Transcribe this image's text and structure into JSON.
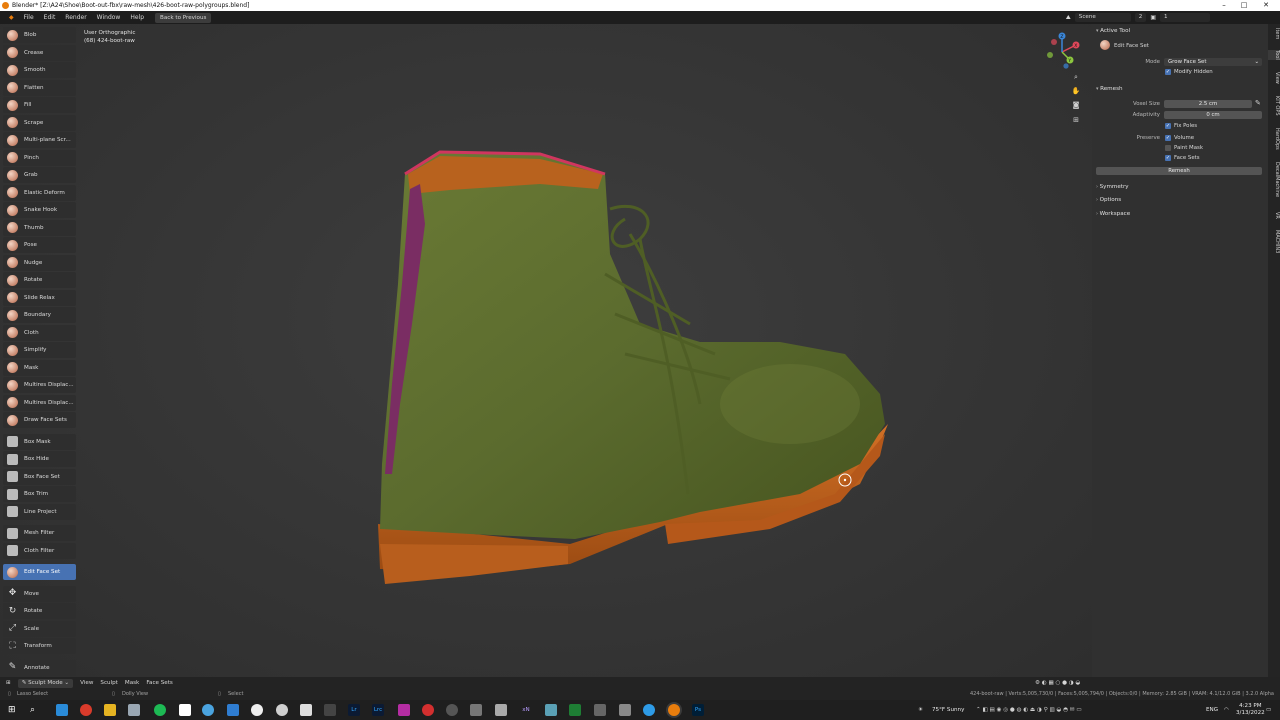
{
  "window": {
    "title": "Blender* [Z:\\A24\\Shoe\\Boot-out-fbx\\raw-mesh\\426-boot-raw-polygroups.blend]",
    "min": "–",
    "max": "□",
    "close": "✕"
  },
  "menu": {
    "items": [
      "File",
      "Edit",
      "Render",
      "Window",
      "Help"
    ],
    "back_button": "Back to Previous",
    "scene_label": "Scene",
    "scene_count": "2",
    "view_layer": "1"
  },
  "viewport": {
    "view_name": "User Orthographic",
    "object_line": "(68) 424-boot-raw"
  },
  "toolbar": {
    "groups": [
      [
        "Blob",
        "Crease",
        "Smooth",
        "Flatten",
        "Fill",
        "Scrape",
        "Multi-plane Scr...",
        "Pinch",
        "Grab",
        "Elastic Deform",
        "Snake Hook",
        "Thumb",
        "Pose",
        "Nudge",
        "Rotate",
        "Slide Relax",
        "Boundary",
        "Cloth",
        "Simplify",
        "Mask",
        "Multires Displac...",
        "Multires Displac...",
        "Draw Face Sets"
      ],
      [
        "Box Mask",
        "Box Hide",
        "Box Face Set",
        "Box Trim",
        "Line Project"
      ],
      [
        "Mesh Filter",
        "Cloth Filter"
      ],
      [
        "Edit Face Set"
      ],
      [
        "Move",
        "Rotate",
        "Scale",
        "Transform"
      ],
      [
        "Annotate"
      ]
    ],
    "active": "Edit Face Set"
  },
  "gizmo": {
    "x": "X",
    "y": "Y",
    "z": "Z"
  },
  "sidebar": {
    "tabs": [
      "Item",
      "Tool",
      "View",
      "KIT OPS",
      "HardOps",
      "DecalMachine",
      "VR",
      "MACHIN3"
    ],
    "active_tool": {
      "header": "Active Tool",
      "tool_name": "Edit Face Set",
      "mode_label": "Mode",
      "mode_value": "Grow Face Set",
      "modify_hidden": "Modify Hidden"
    },
    "remesh": {
      "header": "Remesh",
      "voxel_size_label": "Voxel Size",
      "voxel_size_value": "2.5 cm",
      "adaptivity_label": "Adaptivity",
      "adaptivity_value": "0 cm",
      "fix_poles": "Fix Poles",
      "preserve_label": "Preserve",
      "volume": "Volume",
      "paint_mask": "Paint Mask",
      "face_sets": "Face Sets",
      "button": "Remesh"
    },
    "collapsed": [
      "Symmetry",
      "Options",
      "Workspace"
    ]
  },
  "modebar": {
    "mode": "Sculpt Mode",
    "items": [
      "View",
      "Sculpt",
      "Mask",
      "Face Sets"
    ]
  },
  "statusbar": {
    "lasso": "Lasso Select",
    "dolly": "Dolly View",
    "select": "Select",
    "stats": "424-boot-raw | Verts:5,005,730/0 | Faces:5,005,794/0 | Objects:0/0 | Memory: 2.85 GiB | VRAM: 4.1/12.0 GiB | 3.2.0 Alpha"
  },
  "taskbar": {
    "weather": "75°F  Sunny",
    "lang": "ENG",
    "time": "4:23 PM",
    "date": "3/13/2022",
    "app_labels": {
      "lr": "Lr",
      "lrc": "Lrc",
      "ps": "Ps",
      "xn": "xN"
    }
  },
  "colors": {
    "accent": "#4772b3",
    "boot_green": "#5b6b2e",
    "sole_orange": "#c8641c",
    "zipper": "#7a2d63"
  }
}
